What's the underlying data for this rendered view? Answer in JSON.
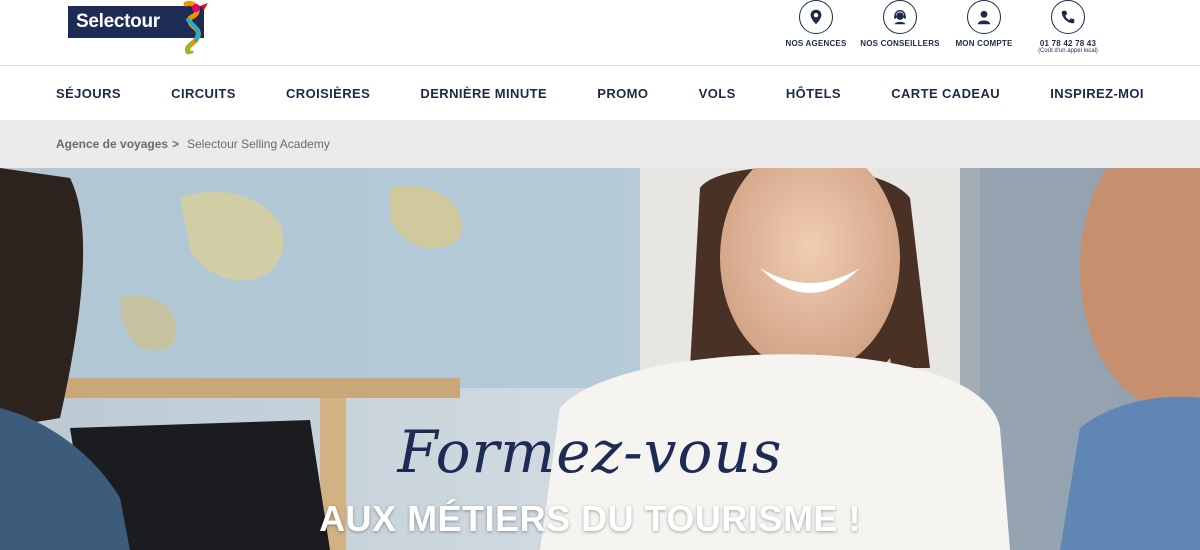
{
  "brand": {
    "name": "Selectour",
    "navy": "#1d2b55"
  },
  "utilities": [
    {
      "label": "NOS AGENCES",
      "icon": "location-pin-icon"
    },
    {
      "label": "NOS CONSEILLERS",
      "icon": "headset-agent-icon"
    },
    {
      "label": "MON COMPTE",
      "icon": "user-account-icon"
    },
    {
      "label": "01 78 42 78 43",
      "sub": "(Coût d'un appel local)",
      "icon": "phone-icon"
    }
  ],
  "nav": {
    "items": [
      "SÉJOURS",
      "CIRCUITS",
      "CROISIÈRES",
      "DERNIÈRE MINUTE",
      "PROMO",
      "VOLS",
      "HÔTELS",
      "CARTE CADEAU",
      "INSPIREZ-MOI"
    ]
  },
  "breadcrumb": {
    "parent": "Agence de voyages",
    "separator": ">",
    "current": "Selectour Selling Academy"
  },
  "hero": {
    "script": "Formez-vous",
    "title": "AUX MÉTIERS DU TOURISME !"
  }
}
